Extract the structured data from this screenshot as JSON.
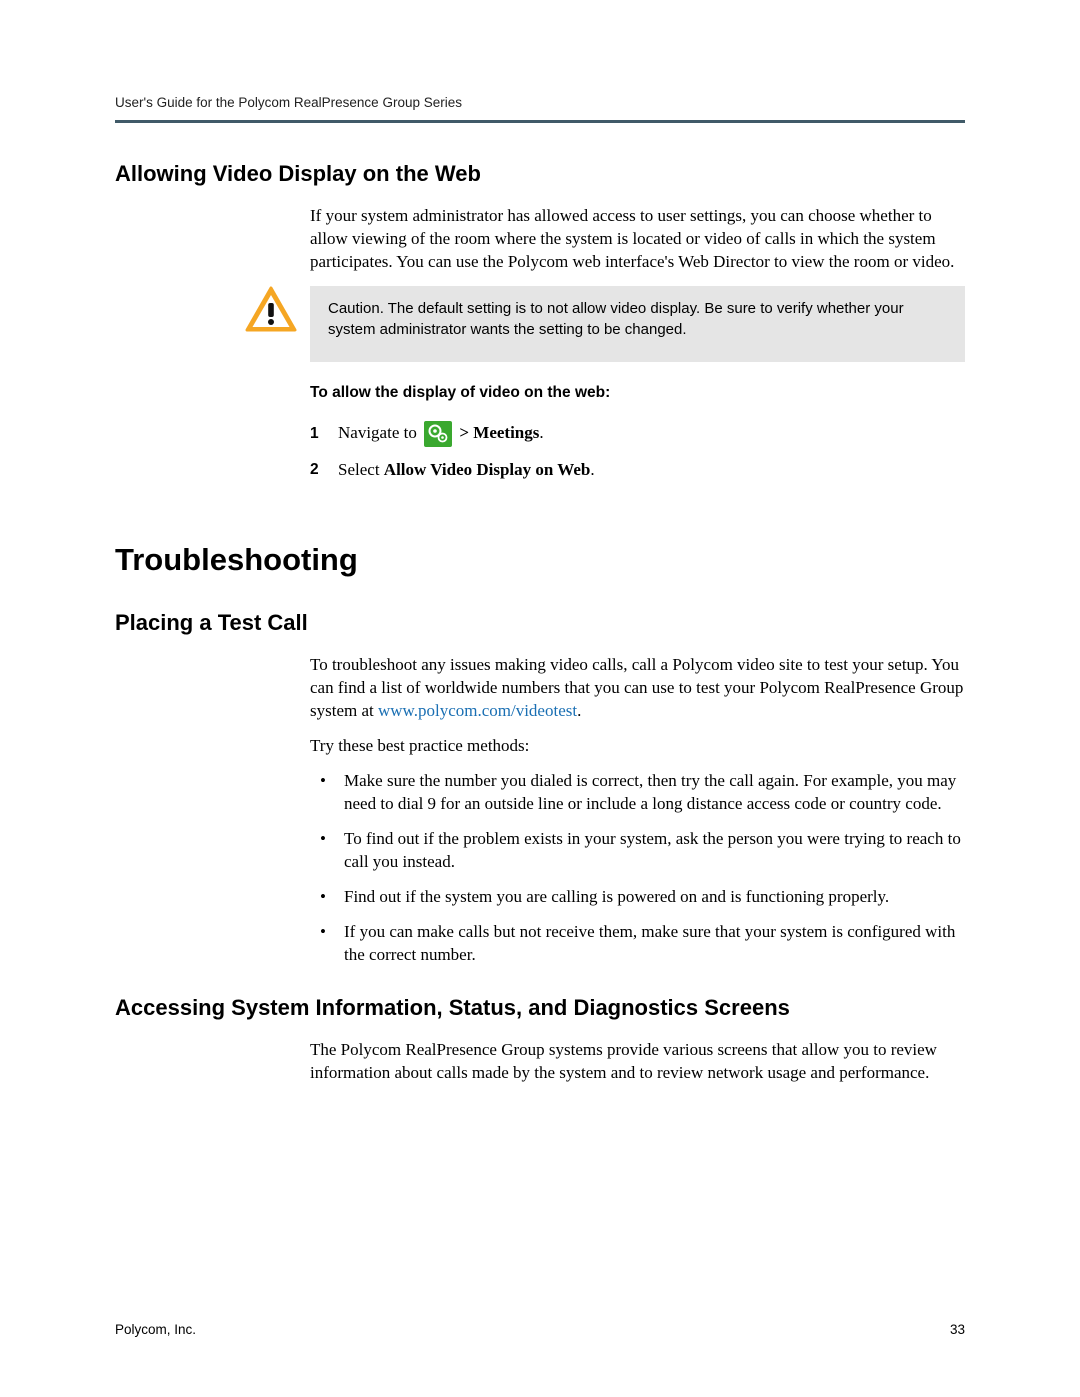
{
  "header": {
    "running_head": "User's Guide for the Polycom RealPresence Group Series"
  },
  "sections": {
    "allow_video": {
      "title": "Allowing Video Display on the Web",
      "intro": "If your system administrator has allowed access to user settings, you can choose whether to allow viewing of the room where the system is located or video of calls in which the system participates. You can use the Polycom web interface's Web Director to view the room or video.",
      "caution": "Caution. The default setting is to not allow video display. Be sure to verify whether your system administrator wants the setting to be changed.",
      "proc_head": "To allow the display of video on the web:",
      "step1_pre": "Navigate to ",
      "step1_post_bold": " > Meetings",
      "step1_period": ".",
      "step2_pre": "Select ",
      "step2_bold": "Allow Video Display on Web",
      "step2_period": "."
    },
    "troubleshooting": {
      "title": "Troubleshooting"
    },
    "test_call": {
      "title": "Placing a Test Call",
      "p1_pre": "To troubleshoot any issues making video calls, call a Polycom video site to test your setup. You can find a list of worldwide numbers that you can use to test your Polycom RealPresence Group system at ",
      "p1_link": "www.polycom.com/videotest",
      "p1_post": ".",
      "p2": "Try these best practice methods:",
      "bullets": [
        "Make sure the number you dialed is correct, then try the call again. For example, you may need to dial 9 for an outside line or include a long distance access code or country code.",
        "To find out if the problem exists in your system, ask the person you were trying to reach to call you instead.",
        "Find out if the system you are calling is powered on and is functioning properly.",
        "If you can make calls but not receive them, make sure that your system is configured with the correct number."
      ]
    },
    "sys_info": {
      "title": "Accessing System Information, Status, and Diagnostics Screens",
      "p1": "The Polycom RealPresence Group systems provide various screens that allow you to review information about calls made by the system and to review network usage and performance."
    }
  },
  "footer": {
    "company": "Polycom, Inc.",
    "page": "33"
  }
}
